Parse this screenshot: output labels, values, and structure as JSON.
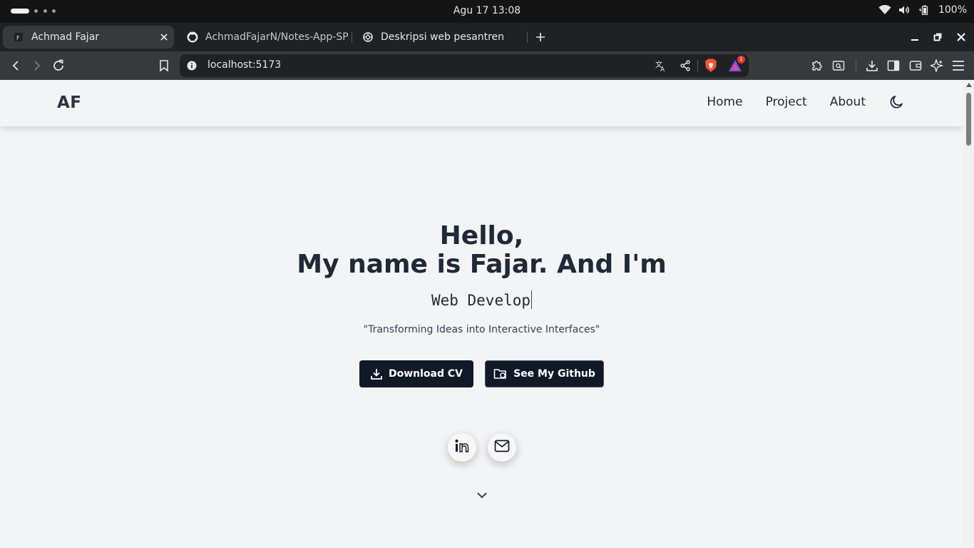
{
  "os": {
    "clock": "Agu 17  13:08",
    "battery": "100%",
    "icons": [
      "wifi-icon",
      "volume-icon",
      "battery-icon"
    ]
  },
  "browser": {
    "tabs": [
      {
        "title": "Achmad Fajar",
        "icon": "site-favicon",
        "active": true
      },
      {
        "title": "AchmadFajarN/Notes-App-SP",
        "icon": "github-icon",
        "active": false
      },
      {
        "title": "Deskripsi web pesantren",
        "icon": "chatgpt-icon",
        "active": false
      }
    ],
    "url": "localhost:5173",
    "notification_count": "1",
    "colors": {
      "tab_strip": "#202124",
      "toolbar": "#38393c",
      "active_tab": "#38393c"
    }
  },
  "site": {
    "logo": "AF",
    "nav": {
      "home": "Home",
      "project": "Project",
      "about": "About"
    },
    "hero": {
      "hello": "Hello,",
      "intro": "My name is Fajar. And I'm",
      "role": "Web Develop",
      "tagline": "\"Transforming Ideas into Interactive Interfaces\"",
      "download_cv": "Download CV",
      "github": "See My Github"
    },
    "colors": {
      "background": "#f3f4f6",
      "text": "#1f2937",
      "button": "#111827"
    }
  }
}
